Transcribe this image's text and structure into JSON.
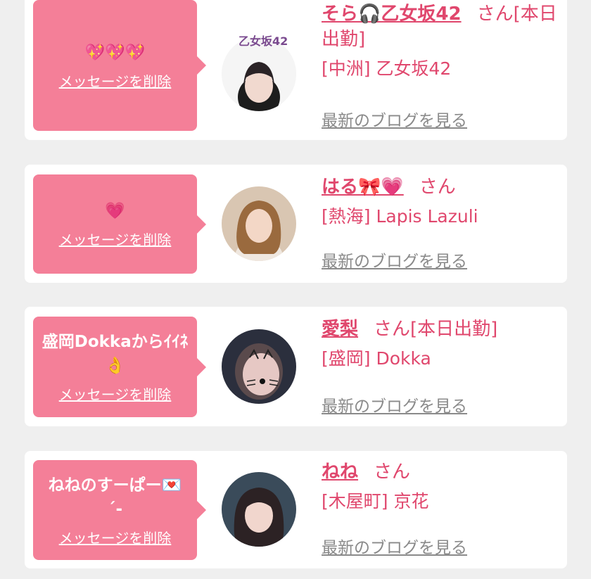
{
  "colors": {
    "accent": "#e0476d",
    "bubble": "#f47f98",
    "background": "#efefef",
    "link_gray": "#8a8a8a"
  },
  "cards": [
    {
      "message": "💖💖💖",
      "delete_label": "メッセージを削除",
      "avatar_logo_text": "乙女坂42",
      "name": "そら🎧乙女坂42",
      "honorific": "さん[本日出勤]",
      "shop": "[中洲] 乙女坂42",
      "blog_label": "最新のブログを見る"
    },
    {
      "message": "💗",
      "delete_label": "メッセージを削除",
      "name": "はる🎀💗",
      "honorific": "さん",
      "shop": "[熱海] Lapis Lazuli",
      "blog_label": "最新のブログを見る"
    },
    {
      "message": "盛岡Dokkaからｲｲﾈ👌",
      "delete_label": "メッセージを削除",
      "name": "愛梨",
      "honorific": "さん[本日出勤]",
      "shop": "[盛岡] Dokka",
      "blog_label": "最新のブログを見る"
    },
    {
      "message": "ねねのすーぱー💌 ´-",
      "delete_label": "メッセージを削除",
      "name": "ねね",
      "honorific": "さん",
      "shop": "[木屋町] 京花",
      "blog_label": "最新のブログを見る"
    }
  ]
}
